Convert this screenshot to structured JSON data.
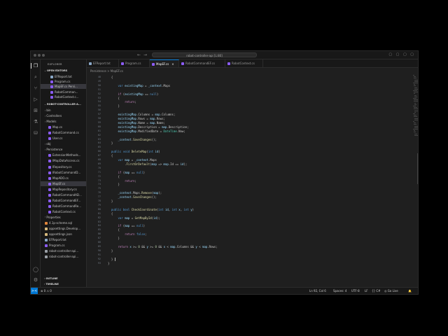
{
  "window": {
    "search_text": "robot-controller-api [L:80]",
    "nav_back": "←",
    "nav_forward": "→",
    "layout_icons": "▢ ▢ ▢ ▢"
  },
  "activity_bar": [
    "files-icon",
    "search-icon",
    "source-control-icon",
    "run-debug-icon",
    "extensions-icon",
    "testing-icon",
    "database-icon",
    "account-icon",
    "settings-icon"
  ],
  "sidebar": {
    "title": "EXPLORER",
    "open_editors_label": "OPEN EDITORS",
    "open_editors": [
      {
        "label": "EFReport.txt",
        "icon": "txt"
      },
      {
        "label": "Program.cs",
        "icon": "cs"
      },
      {
        "label": "MapEF.cs Persi...",
        "icon": "cs",
        "selected": true
      },
      {
        "label": "RobotComman...",
        "icon": "cs"
      },
      {
        "label": "RobotContext.c...",
        "icon": "cs"
      }
    ],
    "project_label": "ROBOT-CONTROLLER-A...",
    "tree": [
      {
        "label": "bin",
        "indent": 1,
        "icon": "chev"
      },
      {
        "label": "Controllers",
        "indent": 1,
        "icon": "chev"
      },
      {
        "label": "Models",
        "indent": 1,
        "icon": "chev"
      },
      {
        "label": "Map.cs",
        "indent": 2,
        "icon": "cs"
      },
      {
        "label": "RobotCommand.cs",
        "indent": 2,
        "icon": "cs"
      },
      {
        "label": "User.cs",
        "indent": 2,
        "icon": "cs"
      },
      {
        "label": "obj",
        "indent": 1,
        "icon": "chev"
      },
      {
        "label": "Persistence",
        "indent": 1,
        "icon": "chev"
      },
      {
        "label": "ExtensionMethods...",
        "indent": 2,
        "icon": "cs"
      },
      {
        "label": "IMapDataAccess.cs",
        "indent": 2,
        "icon": "cs"
      },
      {
        "label": "IRepository.cs",
        "indent": 2,
        "icon": "cs"
      },
      {
        "label": "IRobotCommandD...",
        "indent": 2,
        "icon": "cs"
      },
      {
        "label": "MapADO.cs",
        "indent": 2,
        "icon": "cs"
      },
      {
        "label": "MapEF.cs",
        "indent": 2,
        "icon": "cs",
        "selected": true
      },
      {
        "label": "MapRepository.cs",
        "indent": 2,
        "icon": "cs"
      },
      {
        "label": "RobotCommandAD...",
        "indent": 2,
        "icon": "cs"
      },
      {
        "label": "RobotCommandEF...",
        "indent": 2,
        "icon": "cs"
      },
      {
        "label": "RobotCommandRe...",
        "indent": 2,
        "icon": "cs"
      },
      {
        "label": "RobotContext.cs",
        "indent": 2,
        "icon": "cs"
      },
      {
        "label": "Properties",
        "indent": 1,
        "icon": "chev"
      },
      {
        "label": "4.1p-scheme.sql",
        "indent": 1,
        "icon": "sql"
      },
      {
        "label": "appsettings.Develop...",
        "indent": 1,
        "icon": "json"
      },
      {
        "label": "appsettings.json",
        "indent": 1,
        "icon": "json"
      },
      {
        "label": "EFReport.txt",
        "indent": 1,
        "icon": "txt"
      },
      {
        "label": "Program.cs",
        "indent": 1,
        "icon": "cs"
      },
      {
        "label": "robot-controller-api...",
        "indent": 1,
        "icon": "file"
      },
      {
        "label": "robot-controller-api...",
        "indent": 1,
        "icon": "file"
      }
    ],
    "outline_label": "OUTLINE",
    "timeline_label": "TIMELINE"
  },
  "tabs": [
    {
      "label": "EFReport.txt",
      "active": false
    },
    {
      "label": "Program.cs",
      "active": false
    },
    {
      "label": "MapEF.cs",
      "active": true
    },
    {
      "label": "RobotCommandEF.cs",
      "active": false
    },
    {
      "label": "RobotContext.cs",
      "active": false
    }
  ],
  "tab_close": "×",
  "breadcrumb": "Persistence  >  MapEF.cs",
  "code_lines": [
    {
      "n": "48",
      "t": "  {"
    },
    {
      "n": "49",
      "t": ""
    },
    {
      "n": "50",
      "t": "      var existingMap = _context.Maps"
    },
    {
      "n": "51",
      "t": ""
    },
    {
      "n": "52",
      "t": "      if (existingMap == null)"
    },
    {
      "n": "53",
      "t": "      {"
    },
    {
      "n": "54",
      "t": "          return;"
    },
    {
      "n": "55",
      "t": "      }"
    },
    {
      "n": "56",
      "t": ""
    },
    {
      "n": "57",
      "t": "      existingMap.Columns = map.Columns;"
    },
    {
      "n": "58",
      "t": "      existingMap.Rows = map.Rows;"
    },
    {
      "n": "59",
      "t": "      existingMap.Name = map.Name;"
    },
    {
      "n": "60",
      "t": "      existingMap.Description = map.Description;"
    },
    {
      "n": "61",
      "t": "      existingMap.ModifiedDate = DateTime.Now;"
    },
    {
      "n": "62",
      "t": ""
    },
    {
      "n": "63",
      "t": "      _context.SaveChanges();"
    },
    {
      "n": "64",
      "t": "  }"
    },
    {
      "n": "65",
      "t": ""
    },
    {
      "n": "66",
      "t": "  public void DeleteMap(int id)"
    },
    {
      "n": "67",
      "t": "  {"
    },
    {
      "n": "68",
      "t": "      var map = _context.Maps"
    },
    {
      "n": "69",
      "t": "          .FirstOrDefault(map => map.Id == id);"
    },
    {
      "n": "70",
      "t": ""
    },
    {
      "n": "71",
      "t": "      if (map == null)"
    },
    {
      "n": "72",
      "t": "      {"
    },
    {
      "n": "73",
      "t": "          return;"
    },
    {
      "n": "74",
      "t": "      }"
    },
    {
      "n": "75",
      "t": ""
    },
    {
      "n": "76",
      "t": "      _context.Maps.Remove(map);"
    },
    {
      "n": "77",
      "t": "      _context.SaveChanges();"
    },
    {
      "n": "78",
      "t": "  }"
    },
    {
      "n": "79",
      "t": ""
    },
    {
      "n": "80",
      "t": "  public bool CheckCoordinate(int id, int x, int y)"
    },
    {
      "n": "81",
      "t": "  {"
    },
    {
      "n": "82",
      "t": "      var map = GetMapById(id);"
    },
    {
      "n": "83",
      "t": ""
    },
    {
      "n": "84",
      "t": "      if (map == null)"
    },
    {
      "n": "85",
      "t": "      {"
    },
    {
      "n": "86",
      "t": "          return false;"
    },
    {
      "n": "87",
      "t": "      }"
    },
    {
      "n": "88",
      "t": ""
    },
    {
      "n": "89",
      "t": "      return x >= 0 && y >= 0 && x < map.Columns && y < map.Rows;"
    },
    {
      "n": "90",
      "t": "  }"
    },
    {
      "n": "91",
      "t": ""
    },
    {
      "n": "92",
      "t": "  }"
    },
    {
      "n": "93",
      "t": "}"
    }
  ],
  "status": {
    "remote": "><",
    "problems": "⊗ 0 ⚠ 0",
    "position": "Ln 92, Col 6",
    "spaces": "Spaces: 4",
    "encoding": "UTF-8",
    "eol": "LF",
    "language": "{} C#",
    "golive": "◎ Go Live",
    "notifications": "🔔"
  },
  "colors": {
    "keyword": "#569cd6",
    "type": "#4ec9b0",
    "method": "#dcdcaa",
    "variable": "#9cdcfe",
    "control": "#c586c0",
    "number": "#b5cea8",
    "accent": "#0078d4"
  }
}
